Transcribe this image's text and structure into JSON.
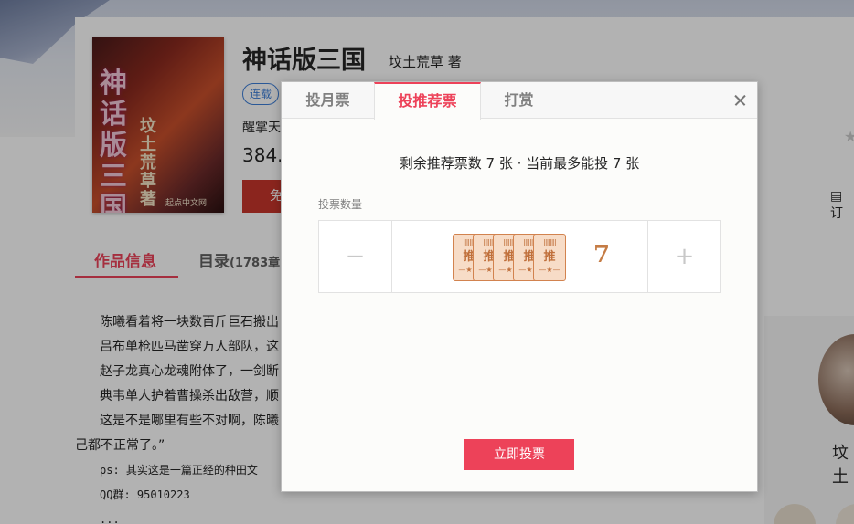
{
  "book": {
    "title": "神话版三国",
    "author": "坟土荒草 著",
    "status_tag": "连载",
    "intro_partial": "醒掌天",
    "wordcount_partial": "384.",
    "read_button_partial": "免",
    "side_link_partial": "订",
    "cover": {
      "title_text": "神话版三国",
      "author_text": "坟土荒草著",
      "publisher": "起点中文网"
    }
  },
  "page_tabs": {
    "info": "作品信息",
    "toc": "目录",
    "toc_count": "(1783章"
  },
  "synopsis": [
    "陈曦看着将一块数百斤巨石搬出",
    "吕布单枪匹马凿穿万人部队，这",
    "赵子龙真心龙魂附体了，一剑断",
    "典韦单人护着曹操杀出敌营，顺",
    "这是不是哪里有些不对啊，陈曦",
    "己都不正常了。”",
    "ps: 其实这是一篇正经的种田文",
    "QQ群: 95010223",
    "..."
  ],
  "right_panel": {
    "name_partial": "坟土"
  },
  "modal": {
    "tabs": [
      {
        "label": "投月票",
        "active": false
      },
      {
        "label": "投推荐票",
        "active": true
      },
      {
        "label": "打赏",
        "active": false
      }
    ],
    "remaining_text": "剩余推荐票数 7 张 · 当前最多能投 7 张",
    "quantity_label": "投票数量",
    "quantity": "7",
    "minus_symbol": "−",
    "plus_symbol": "+",
    "ticket": {
      "top": "||||||||",
      "mid": "推",
      "bot": "—★—"
    },
    "ticket_count": 5,
    "submit_label": "立即投票"
  },
  "colors": {
    "accent": "#ed4259",
    "ticket_fill": "#f7dcc7",
    "ticket_stroke": "#d2834f",
    "quantity_text": "#c57c45",
    "serial_tag": "#3d7fd8"
  }
}
